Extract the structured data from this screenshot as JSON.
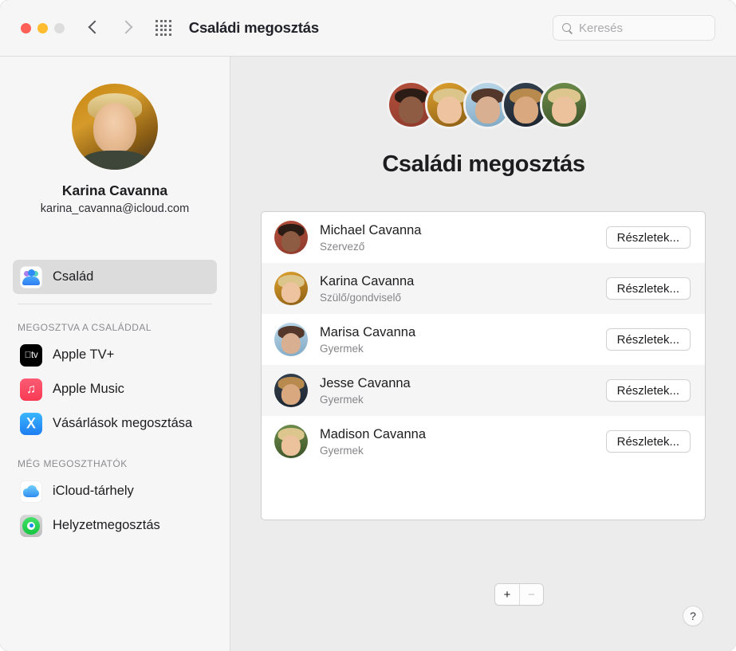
{
  "window": {
    "title": "Családi megosztás",
    "traffic_lights": [
      "close-button",
      "minimize-button",
      "zoom-button"
    ],
    "nav": {
      "back": "back-chevron",
      "forward": "forward-chevron",
      "grid": "show-all-grid"
    },
    "search": {
      "placeholder": "Keresés",
      "value": "",
      "icon": "search-icon"
    }
  },
  "sidebar": {
    "profile": {
      "name": "Karina Cavanna",
      "email": "karina_cavanna@icloud.com"
    },
    "primary": [
      {
        "label": "Család",
        "icon": "family-icon",
        "selected": true
      }
    ],
    "sections": [
      {
        "header": "MEGOSZTVA A CSALÁDDAL",
        "items": [
          {
            "label": "Apple TV+",
            "icon": "apple-tv-icon"
          },
          {
            "label": "Apple Music",
            "icon": "apple-music-icon"
          },
          {
            "label": "Vásárlások megosztása",
            "icon": "app-store-icon"
          }
        ]
      },
      {
        "header": "MÉG MEGOSZTHATÓK",
        "items": [
          {
            "label": "iCloud-tárhely",
            "icon": "icloud-icon"
          },
          {
            "label": "Helyzetmegosztás",
            "icon": "find-my-icon"
          }
        ]
      }
    ]
  },
  "main": {
    "title": "Családi megosztás",
    "avatar_stack": [
      "Michael Cavanna",
      "Karina Cavanna",
      "Marisa Cavanna",
      "Jesse Cavanna",
      "Madison Cavanna"
    ],
    "members": [
      {
        "name": "Michael Cavanna",
        "role": "Szervező",
        "button": "Részletek..."
      },
      {
        "name": "Karina Cavanna",
        "role": "Szülő/gondviselő",
        "button": "Részletek..."
      },
      {
        "name": "Marisa Cavanna",
        "role": "Gyermek",
        "button": "Részletek..."
      },
      {
        "name": "Jesse Cavanna",
        "role": "Gyermek",
        "button": "Részletek..."
      },
      {
        "name": "Madison Cavanna",
        "role": "Gyermek",
        "button": "Részletek..."
      }
    ],
    "add_button": "+",
    "remove_button": "−",
    "help_button": "?"
  },
  "colors": {
    "window_bg": "#ececec",
    "sidebar_bg": "#f6f6f6",
    "panel_bg": "#ffffff",
    "selected_row": "#dcdcdc",
    "text_primary": "#1d1d20",
    "text_secondary": "#85858a"
  }
}
